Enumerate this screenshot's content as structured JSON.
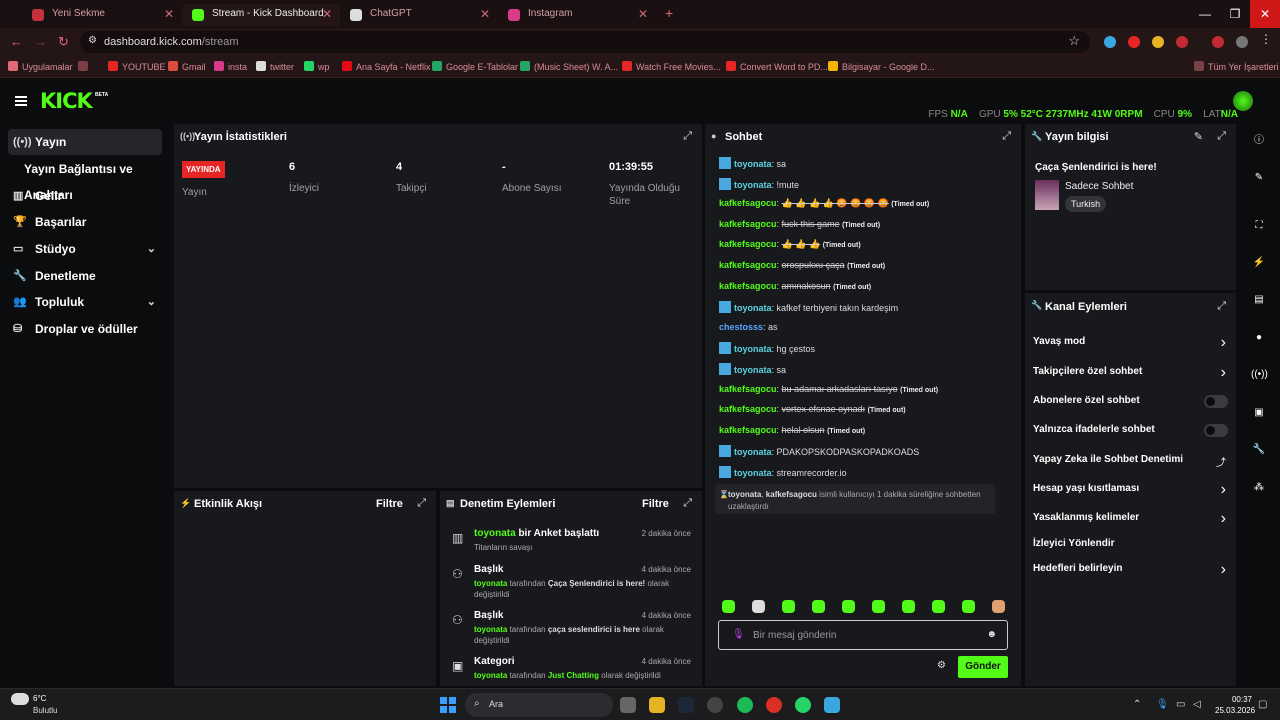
{
  "browser": {
    "tabs": [
      {
        "title": "Yeni Sekme",
        "active": false
      },
      {
        "title": "Stream - Kick Dashboard",
        "active": true
      },
      {
        "title": "ChatGPT",
        "active": false
      },
      {
        "title": "Instagram",
        "active": false
      }
    ],
    "url_host": "dashboard.kick.com",
    "url_path": "/stream",
    "bookmarks": [
      "Uygulamalar",
      "YOUTUBE",
      "Gmail",
      "insta",
      "twitter",
      "wp",
      "Ana Sayfa - Netflix",
      "Google E-Tablolar",
      "(Music Sheet) W. A...",
      "Watch Free Movies...",
      "Convert Word to PD...",
      "Bilgisayar - Google D...",
      "Tüm Yer İşaretleri"
    ]
  },
  "header": {
    "logo": "KICK",
    "beta": "BETA",
    "stats": {
      "fps_label": "FPS",
      "fps_value": "N/A",
      "gpu_label": "GPU",
      "gpu_pct": "5",
      "gpu_temp": "52",
      "gpu_clock": "2737",
      "gpu_power": "41",
      "gpu_rpm": "0",
      "cpu_label": "CPU",
      "cpu_pct": "9",
      "lat_label": "LAT",
      "lat_value": "N/A"
    }
  },
  "nav": {
    "items": [
      {
        "label": "Yayın",
        "icon": "broadcast-icon"
      },
      {
        "label": "Yayın Bağlantısı ve Anahtarı",
        "icon": ""
      },
      {
        "label": "Gelir",
        "icon": "revenue-icon"
      },
      {
        "label": "Başarılar",
        "icon": "trophy-icon"
      },
      {
        "label": "Stüdyo",
        "icon": "studio-icon"
      },
      {
        "label": "Denetleme",
        "icon": "wrench-icon"
      },
      {
        "label": "Topluluk",
        "icon": "community-icon"
      },
      {
        "label": "Droplar ve ödüller",
        "icon": "gift-icon"
      }
    ]
  },
  "stream_stats": {
    "title": "Yayın İstatistikleri",
    "live_badge": "YAYINDA",
    "status_label": "Yayın",
    "viewers_value": "6",
    "viewers_label": "İzleyici",
    "followers_value": "4",
    "followers_label": "Takipçi",
    "subs_value": "-",
    "subs_label": "Abone Sayısı",
    "uptime_value": "01:39:55",
    "uptime_label": "Yayında Olduğu Süre"
  },
  "activity": {
    "title": "Etkinlik Akışı",
    "filter": "Filtre"
  },
  "modlog": {
    "title": "Denetim Eylemleri",
    "filter": "Filtre",
    "entries": [
      {
        "user": "toyonata",
        "action": "bir Anket başlattı",
        "sub": "Titanların savaşı",
        "time": "2 dakika önce"
      },
      {
        "title": "Başlık",
        "user": "toyonata",
        "mid": "tarafından",
        "value": "Çaça Şenlendirici is here!",
        "tail": "olarak değiştirildi",
        "time": "4 dakika önce"
      },
      {
        "title": "Başlık",
        "user": "toyonata",
        "mid": "tarafından",
        "value": "çaça seslendirici is here",
        "tail": "olarak değiştirildi",
        "time": "4 dakika önce"
      },
      {
        "title": "Kategori",
        "user": "toyonata",
        "mid": "tarafından",
        "value": "Just Chatting",
        "tail": "olarak değiştirildi",
        "time": "4 dakika önce"
      }
    ]
  },
  "chat": {
    "title": "Sohbet",
    "messages": [
      {
        "user": "toyonata",
        "text": "sa",
        "mod": true
      },
      {
        "user": "toyonata",
        "text": "!mute",
        "mod": true
      },
      {
        "user": "kafkefsagocu",
        "text": "👍 👍 👍 👍 😡 😡 😡 😡",
        "timeout": "(Timed out)"
      },
      {
        "user": "kafkefsagocu",
        "text": "fuck this game",
        "timeout": "(Timed out)"
      },
      {
        "user": "kafkefsagocu",
        "text": "👍 👍 👍",
        "timeout": "(Timed out)"
      },
      {
        "user": "kafkefsagocu",
        "text": "orospukxu çaça",
        "timeout": "(Timed out)"
      },
      {
        "user": "kafkefsagocu",
        "text": "amınakosun",
        "timeout": "(Timed out)"
      },
      {
        "user": "toyonata",
        "text": "kafkef terbiyeni takın kardeşim",
        "mod": true
      },
      {
        "user": "chestosss",
        "text": "as",
        "blue": true
      },
      {
        "user": "toyonata",
        "text": "hg çestos",
        "mod": true
      },
      {
        "user": "toyonata",
        "text": "sa",
        "mod": true
      },
      {
        "user": "kafkefsagocu",
        "text": "bu adamaı arkadasları tasıyo",
        "timeout": "(Timed out)"
      },
      {
        "user": "kafkefsagocu",
        "text": "vortex efsnae oynadı",
        "timeout": "(Timed out)"
      },
      {
        "user": "kafkefsagocu",
        "text": "helal olsun",
        "timeout": "(Timed out)"
      },
      {
        "user": "toyonata",
        "text": "PDAKOPSKODPASKOPADKOADS",
        "mod": true
      },
      {
        "user": "toyonata",
        "text": "streamrecorder.io",
        "mod": true
      }
    ],
    "system": {
      "user1": "toyonata",
      "user2": "kafkefsagocu",
      "text": "isimli kullanıcıyı 1 dakika süreliğine sohbetten uzaklaştırdı"
    },
    "input_placeholder": "Bir mesaj gönderin",
    "send": "Gönder"
  },
  "stream_info": {
    "title": "Yayın bilgisi",
    "stream_title": "Çaça Şenlendirici is here!",
    "category": "Sadece Sohbet",
    "tag": "Turkish"
  },
  "channel_actions": {
    "title": "Kanal Eylemleri",
    "items": [
      {
        "label": "Yavaş mod",
        "type": "chevron"
      },
      {
        "label": "Takipçilere özel sohbet",
        "type": "chevron"
      },
      {
        "label": "Abonelere özel sohbet",
        "type": "toggle"
      },
      {
        "label": "Yalnızca ifadelerle sohbet",
        "type": "toggle"
      },
      {
        "label": "Yapay Zeka ile Sohbet Denetimi",
        "type": "external"
      },
      {
        "label": "Hesap yaşı kısıtlaması",
        "type": "chevron"
      },
      {
        "label": "Yasaklanmış kelimeler",
        "type": "chevron"
      },
      {
        "label": "İzleyici Yönlendir",
        "type": "none"
      },
      {
        "label": "Hedefleri belirleyin",
        "type": "chevron"
      }
    ]
  },
  "taskbar": {
    "temp": "6°C",
    "weather": "Bulutlu",
    "search": "Ara",
    "time": "00:37",
    "date": "25.03.2026"
  },
  "colors": {
    "accent": "#53fc18",
    "live": "#e62525",
    "panel": "#18191c",
    "bg": "#0b0c0e"
  }
}
